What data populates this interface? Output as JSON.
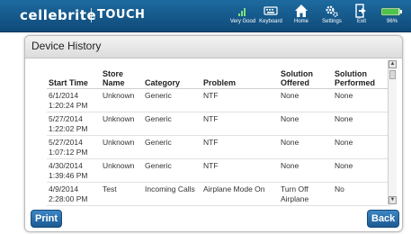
{
  "app": {
    "brand": "cellebrite",
    "product": "TOUCH"
  },
  "toolbar": {
    "signal": {
      "label": "Very Good",
      "icon": "signal-bars-icon"
    },
    "keyboard": {
      "label": "Keyboard",
      "icon": "keyboard-icon"
    },
    "home": {
      "label": "Home",
      "icon": "home-icon"
    },
    "settings": {
      "label": "Settings",
      "icon": "gear-icon"
    },
    "exit": {
      "label": "Exit",
      "icon": "exit-icon"
    },
    "battery": {
      "label": "96%",
      "icon": "battery-icon",
      "level": 0.96
    }
  },
  "panel": {
    "title": "Device History",
    "columns": [
      "Start Time",
      "Store Name",
      "Category",
      "Problem",
      "Solution Offered",
      "Solution Performed"
    ],
    "rows": [
      [
        "6/1/2014 1:20:24 PM",
        "Unknown",
        "Generic",
        "NTF",
        "None",
        "None"
      ],
      [
        "5/27/2014 1:22:02 PM",
        "Unknown",
        "Generic",
        "NTF",
        "None",
        "None"
      ],
      [
        "5/27/2014 1:07:12 PM",
        "Unknown",
        "Generic",
        "NTF",
        "None",
        "None"
      ],
      [
        "4/30/2014 1:39:46 PM",
        "Unknown",
        "Generic",
        "NTF",
        "None",
        "None"
      ],
      [
        "4/9/2014 2:28:00 PM",
        "Test",
        "Incoming Calls",
        "Airplane Mode On",
        "Turn Off Airplane",
        "No"
      ]
    ]
  },
  "buttons": {
    "print": "Print",
    "back": "Back"
  },
  "colors": {
    "topbar": "#1b5e92",
    "button": "#2a6fae",
    "battery": "#4ec34a"
  }
}
